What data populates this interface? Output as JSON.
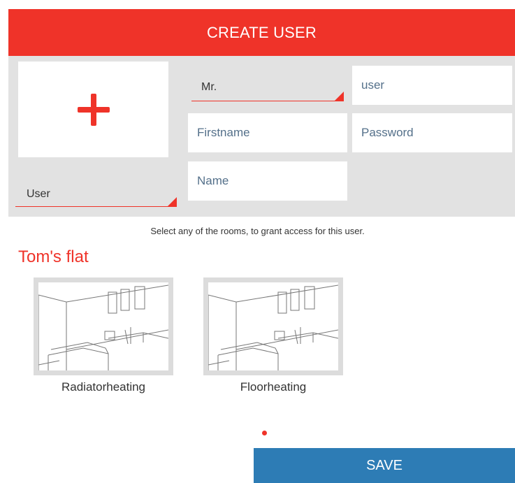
{
  "header": {
    "title": "CREATE USER"
  },
  "form": {
    "salutation": "Mr.",
    "username_placeholder": "user",
    "firstname_placeholder": "Firstname",
    "password_placeholder": "Password",
    "name_placeholder": "Name",
    "role": "User"
  },
  "rooms_section": {
    "hint": "Select any of the rooms, to grant access for this user.",
    "flat_name": "Tom's flat",
    "rooms": [
      {
        "label": "Radiatorheating"
      },
      {
        "label": "Floorheating"
      }
    ]
  },
  "pager": {
    "dots": 1,
    "active": 1
  },
  "actions": {
    "save_label": "SAVE"
  },
  "colors": {
    "accent": "#ef3329",
    "panel": "#e2e2e2",
    "primary_button": "#2d7cb5"
  }
}
